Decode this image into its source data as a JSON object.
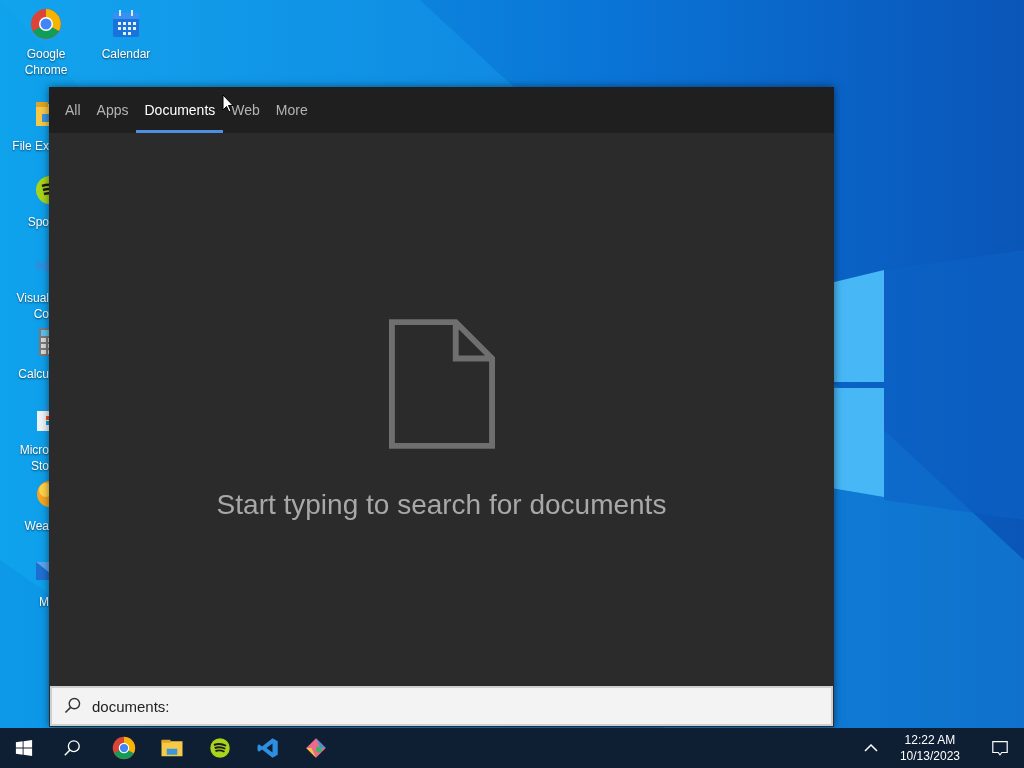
{
  "desktop_icons_top": [
    {
      "label_lines": [
        "Google",
        "Chrome"
      ]
    },
    {
      "label_lines": [
        "Calendar"
      ]
    }
  ],
  "desktop_icons_left": [
    {
      "label_lines": [
        "File Ex"
      ]
    },
    {
      "label_lines": [
        "Spo"
      ]
    },
    {
      "label_lines": [
        "Visual",
        "Co"
      ]
    },
    {
      "label_lines": [
        "Calcu"
      ]
    },
    {
      "label_lines": [
        "Micro",
        "Sto"
      ]
    },
    {
      "label_lines": [
        "Wea"
      ]
    },
    {
      "label_lines": [
        "M"
      ]
    }
  ],
  "search_panel": {
    "tabs": [
      {
        "label": "All",
        "selected": false
      },
      {
        "label": "Apps",
        "selected": false
      },
      {
        "label": "Documents",
        "selected": true
      },
      {
        "label": "Web",
        "selected": false
      },
      {
        "label": "More",
        "selected": false
      }
    ],
    "empty_message": "Start typing to search for documents",
    "search_field": {
      "value": "documents:"
    }
  },
  "taskbar": {
    "clock": {
      "time": "12:22 AM",
      "date": "10/13/2023"
    }
  }
}
